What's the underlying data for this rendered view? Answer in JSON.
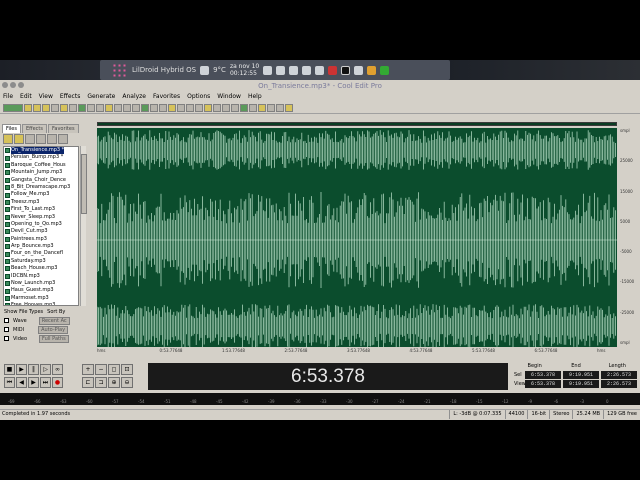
{
  "os_panel": {
    "distro_label": "LilDroid Hybrid OS",
    "temperature": "9°C",
    "date": "za nov 10",
    "time": "00:12:55"
  },
  "window": {
    "title": "On_Transience.mp3* - Cool Edit Pro"
  },
  "menu": [
    "File",
    "Edit",
    "View",
    "Effects",
    "Generate",
    "Analyze",
    "Favorites",
    "Options",
    "Window",
    "Help"
  ],
  "organizer": {
    "tabs": [
      "Files",
      "Effects",
      "Favorites"
    ],
    "files": [
      "On_Transience.mp3 *",
      "Persian_Bump.mp3 *",
      "Baroque_Coffee_Hous",
      "Mountain_Jump.mp3",
      "Gangsta_Choir_Dence",
      "8_Bit_Dreamscape.mp3",
      "Follow_Me.mp3",
      "Treesz.mp3",
      "First_To_Last.mp3",
      "Never_Sleep.mp3",
      "Opening_to_Qo.mp3",
      "Devil_Cut.mp3",
      "Paintrees.mp3",
      "Arp_Bounce.mp3",
      "Four_on_the_Dancefl",
      "Saturday.mp3",
      "Beach_House.mp3",
      "IDCBN.mp3",
      "Now_Launch.mp3",
      "Haus_Guest.mp3",
      "Marmoset.mp3",
      "Free_Hooves.mp3"
    ],
    "show_file_types_label": "Show File Types",
    "sort_by_label": "Sort By",
    "types": [
      "Wave",
      "MIDI",
      "Video"
    ],
    "sort_value": "Recent Ac",
    "full_paths_label": "Full Paths",
    "auto_play_label": "Auto-Play"
  },
  "timeline_ticks": [
    "hms",
    "0:53.77648",
    "1:53.77648",
    "2:53.77648",
    "3:53.77648",
    "4:53.77648",
    "5:53.77648",
    "6:53.77648",
    "hms"
  ],
  "vruler_ticks": [
    "smpl",
    "25000",
    "15000",
    "5000",
    "-5000",
    "-15000",
    "-25000",
    "smpl"
  ],
  "time_display": "6:53.378",
  "selection": {
    "headers": [
      "Begin",
      "End",
      "Length"
    ],
    "sel_label": "Sel",
    "view_label": "View",
    "sel": [
      "6:53.378",
      "9:19.951",
      "2:26.573"
    ],
    "view": [
      "6:53.378",
      "9:19.951",
      "2:26.573"
    ]
  },
  "meter_ticks": [
    "-69",
    "-66",
    "-63",
    "-60",
    "-57",
    "-54",
    "-51",
    "-48",
    "-45",
    "-42",
    "-39",
    "-36",
    "-33",
    "-30",
    "-27",
    "-24",
    "-21",
    "-18",
    "-15",
    "-12",
    "-9",
    "-6",
    "-3",
    "0"
  ],
  "status": {
    "message": "Completed in 1.97 seconds",
    "level": "L: -3dB @ 0:07.335",
    "rate": "44100",
    "bits": "16-bit",
    "channels": "Stereo",
    "size": "25.24 MB",
    "free": "129 GB free"
  },
  "colors": {
    "wave_bg": "#0b4d2d",
    "wave_fg": "#b8e0c8",
    "time_bg": "#1a1a1a"
  }
}
